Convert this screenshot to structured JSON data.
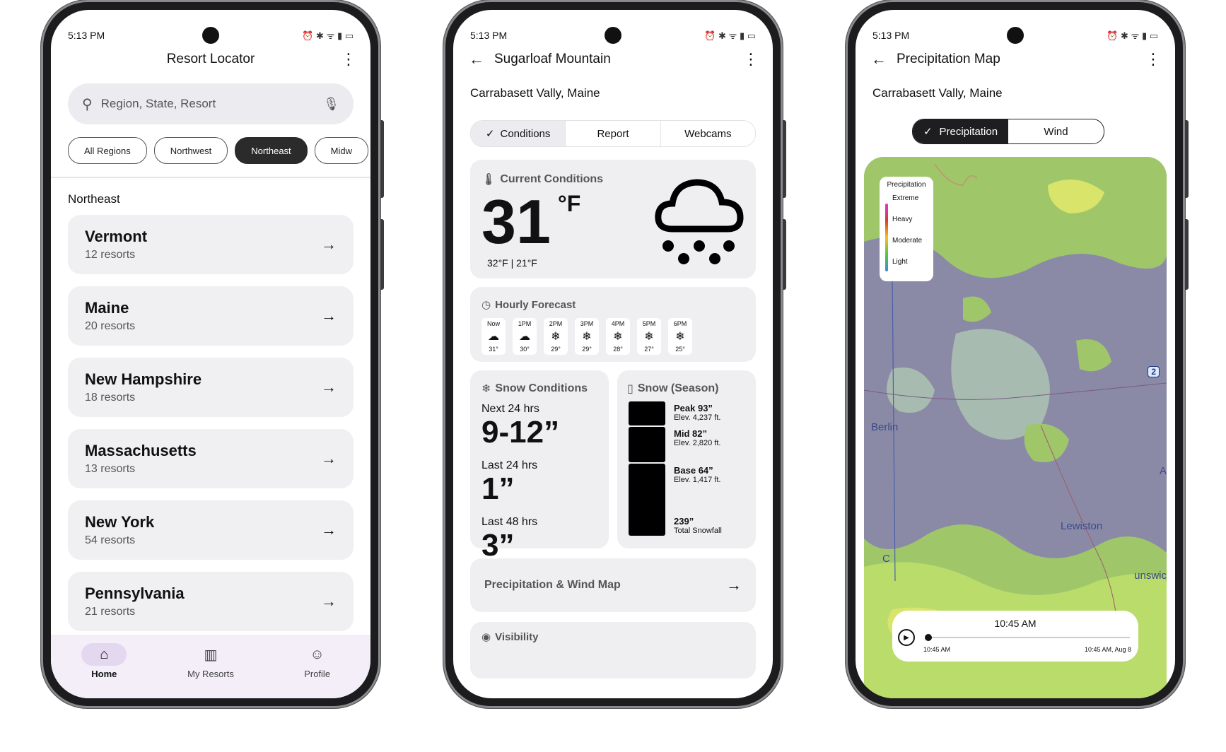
{
  "status": {
    "time": "5:13 PM",
    "icons": "⏰ ✱ ᯤ ▮ ▭"
  },
  "phone1": {
    "title": "Resort Locator",
    "search_placeholder": "Region, State, Resort",
    "chips": [
      "All Regions",
      "Northwest",
      "Northeast",
      "Midw"
    ],
    "active_chip": "Northeast",
    "section": "Northeast",
    "resorts": [
      {
        "name": "Vermont",
        "count": "12 resorts"
      },
      {
        "name": "Maine",
        "count": "20 resorts"
      },
      {
        "name": "New Hampshire",
        "count": "18 resorts"
      },
      {
        "name": "Massachusetts",
        "count": "13 resorts"
      },
      {
        "name": "New York",
        "count": "54 resorts"
      },
      {
        "name": "Pennsylvania",
        "count": "21 resorts"
      }
    ],
    "nav": {
      "home": "Home",
      "my_resorts": "My Resorts",
      "profile": "Profile"
    }
  },
  "phone2": {
    "title": "Sugarloaf Mountain",
    "location": "Carrabasett Vally, Maine",
    "tabs": [
      "Conditions",
      "Report",
      "Webcams"
    ],
    "current": {
      "header": "Current Conditions",
      "temp": "31",
      "unit": "°F",
      "range": "32°F | 21°F"
    },
    "hourly": {
      "header": "Hourly Forecast",
      "hours": [
        {
          "label": "Now",
          "temp": "31°",
          "icon": "☁"
        },
        {
          "label": "1PM",
          "temp": "30°",
          "icon": "☁"
        },
        {
          "label": "2PM",
          "temp": "29°",
          "icon": "❄"
        },
        {
          "label": "3PM",
          "temp": "29°",
          "icon": "❄"
        },
        {
          "label": "4PM",
          "temp": "28°",
          "icon": "❄"
        },
        {
          "label": "5PM",
          "temp": "27°",
          "icon": "❄"
        },
        {
          "label": "6PM",
          "temp": "25°",
          "icon": "❄"
        }
      ]
    },
    "snow": {
      "header": "Snow Conditions",
      "next24_label": "Next 24 hrs",
      "next24": "9-12”",
      "last24_label": "Last 24 hrs",
      "last24": "1”",
      "last48_label": "Last 48 hrs",
      "last48": "3”"
    },
    "season": {
      "header": "Snow (Season)",
      "peak": "Peak 93”",
      "peak_elev": "Elev. 4,237 ft.",
      "mid": "Mid 82”",
      "mid_elev": "Elev. 2,820 ft.",
      "base": "Base 64”",
      "base_elev": "Elev. 1,417 ft.",
      "total": "239”",
      "total_label": "Total Snowfall"
    },
    "map_link": "Precipitation & Wind Map",
    "next_section": "Visibility"
  },
  "phone3": {
    "title": "Precipitation Map",
    "location": "Carrabasett Vally, Maine",
    "toggle": [
      "Precipitation",
      "Wind"
    ],
    "legend_title": "Precipitation",
    "legend": [
      "Extreme",
      "Heavy",
      "Moderate",
      "Light"
    ],
    "map_labels": {
      "berlin": "Berlin",
      "lewiston": "Lewiston",
      "route": "2",
      "a": "A",
      "c": "C",
      "brunswick": "unswic"
    },
    "player_time": "10:45 AM",
    "player_start": "10:45 AM",
    "player_end": "10:45 AM, Aug 8"
  }
}
